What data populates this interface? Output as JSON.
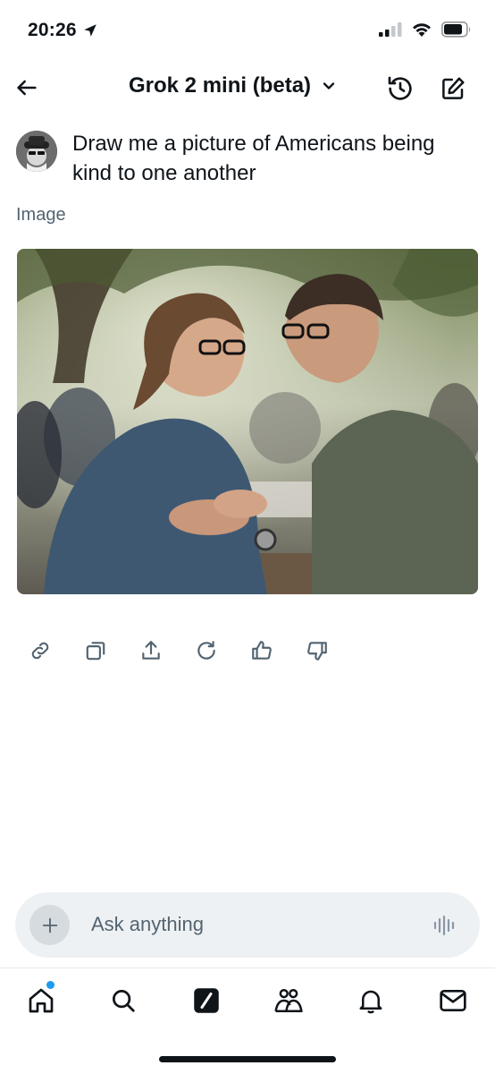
{
  "status_bar": {
    "time": "20:26",
    "icons": [
      "location-arrow-icon",
      "cellular-signal-icon",
      "wifi-icon",
      "battery-icon"
    ]
  },
  "header": {
    "title": "Grok 2 mini (beta)",
    "icons": [
      "back-arrow-icon",
      "chevron-down-icon",
      "history-icon",
      "compose-icon"
    ]
  },
  "conversation": {
    "user_message": "Draw me a picture of Americans being kind to one another",
    "response_label": "Image",
    "image_alt": "Generated image"
  },
  "actions": [
    {
      "name": "link-icon"
    },
    {
      "name": "copy-icon"
    },
    {
      "name": "share-icon"
    },
    {
      "name": "regenerate-icon"
    },
    {
      "name": "thumbs-up-icon"
    },
    {
      "name": "thumbs-down-icon"
    }
  ],
  "input": {
    "placeholder": "Ask anything"
  },
  "bottom_nav": {
    "items": [
      "home-icon",
      "search-icon",
      "grok-icon",
      "communities-icon",
      "notifications-icon",
      "messages-icon"
    ],
    "home_has_badge": true
  },
  "colors": {
    "text_primary": "#0f1419",
    "text_secondary": "#536471",
    "accent": "#1d9bf0",
    "input_bg": "#eef1f3"
  }
}
